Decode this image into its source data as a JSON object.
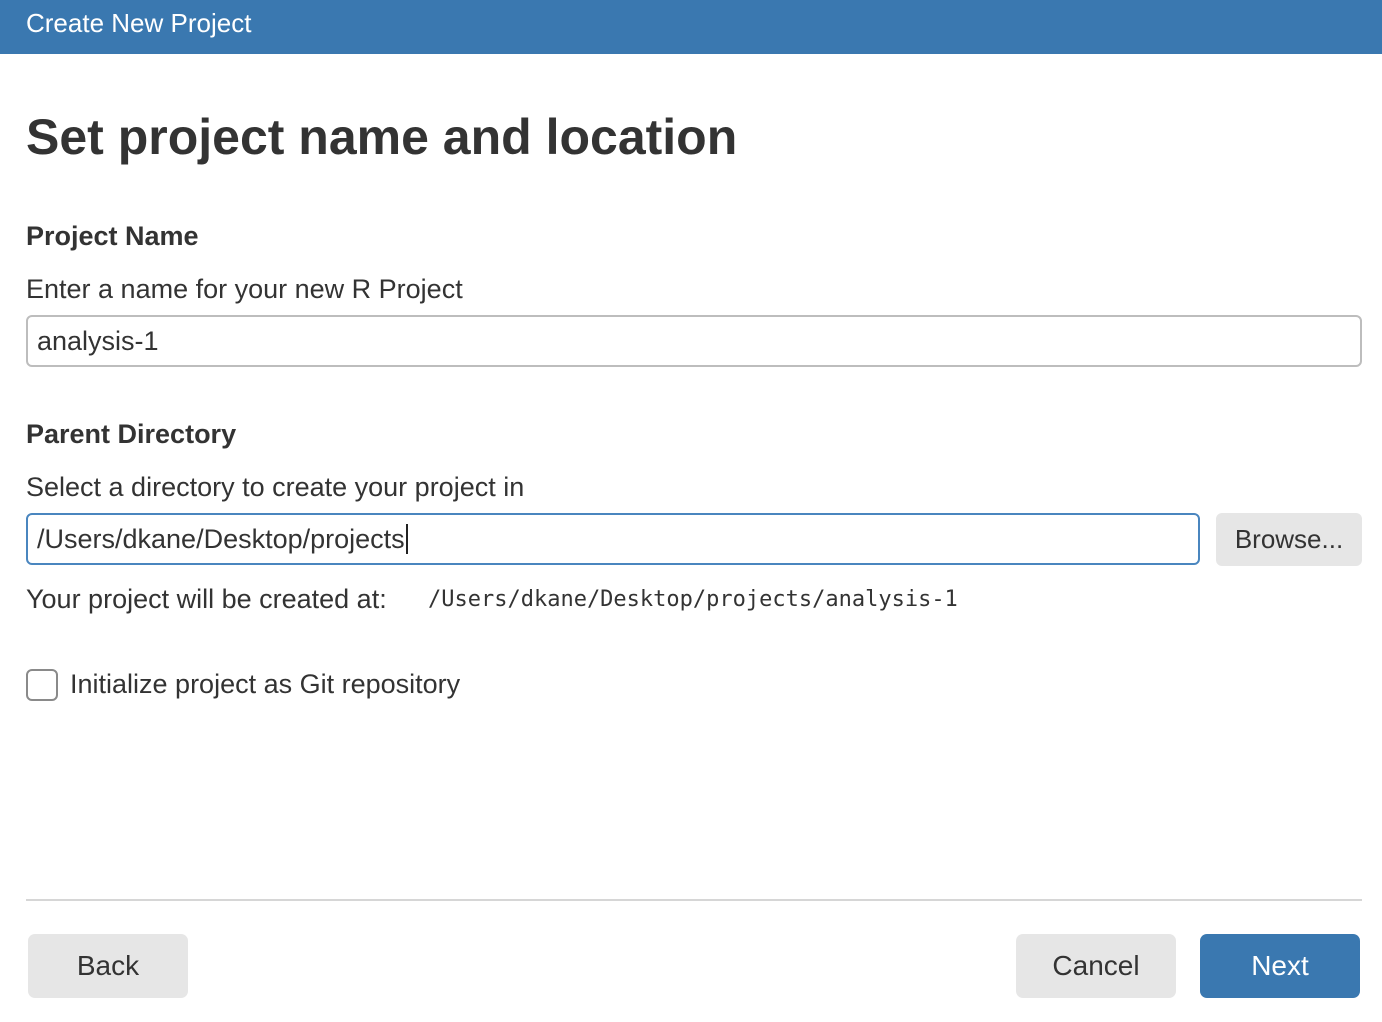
{
  "window": {
    "title": "Create New Project"
  },
  "page": {
    "title": "Set project name and location"
  },
  "project_name": {
    "heading": "Project Name",
    "description": "Enter a name for your new R Project",
    "value": "analysis-1"
  },
  "parent_directory": {
    "heading": "Parent Directory",
    "description": "Select a directory to create your project in",
    "value": "/Users/dkane/Desktop/projects",
    "browse_label": "Browse..."
  },
  "created_at": {
    "label": "Your project will be created at:",
    "path": "/Users/dkane/Desktop/projects/analysis-1"
  },
  "git": {
    "label": "Initialize project as Git repository",
    "checked": false
  },
  "footer": {
    "back_label": "Back",
    "cancel_label": "Cancel",
    "next_label": "Next"
  },
  "colors": {
    "accent": "#3a78b0",
    "focus_border": "#4a86bf",
    "button_gray": "#e6e6e6"
  }
}
